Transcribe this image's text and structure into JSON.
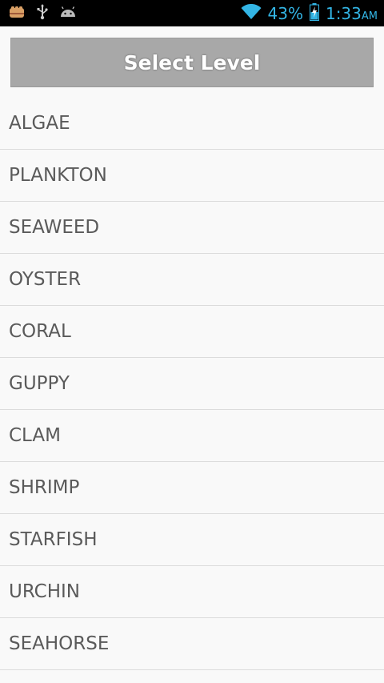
{
  "status_bar": {
    "battery_percent": "43%",
    "time": "1:33",
    "ampm": "AM",
    "icons_left": [
      "fist-icon",
      "usb-icon",
      "android-icon"
    ],
    "icons_right": [
      "wifi-icon",
      "battery-icon"
    ],
    "accent_color": "#33b5e5"
  },
  "header": {
    "title": "Select Level"
  },
  "levels": [
    "ALGAE",
    "PLANKTON",
    "SEAWEED",
    "OYSTER",
    "CORAL",
    "GUPPY",
    "CLAM",
    "SHRIMP",
    "STARFISH",
    "URCHIN",
    "SEAHORSE"
  ]
}
